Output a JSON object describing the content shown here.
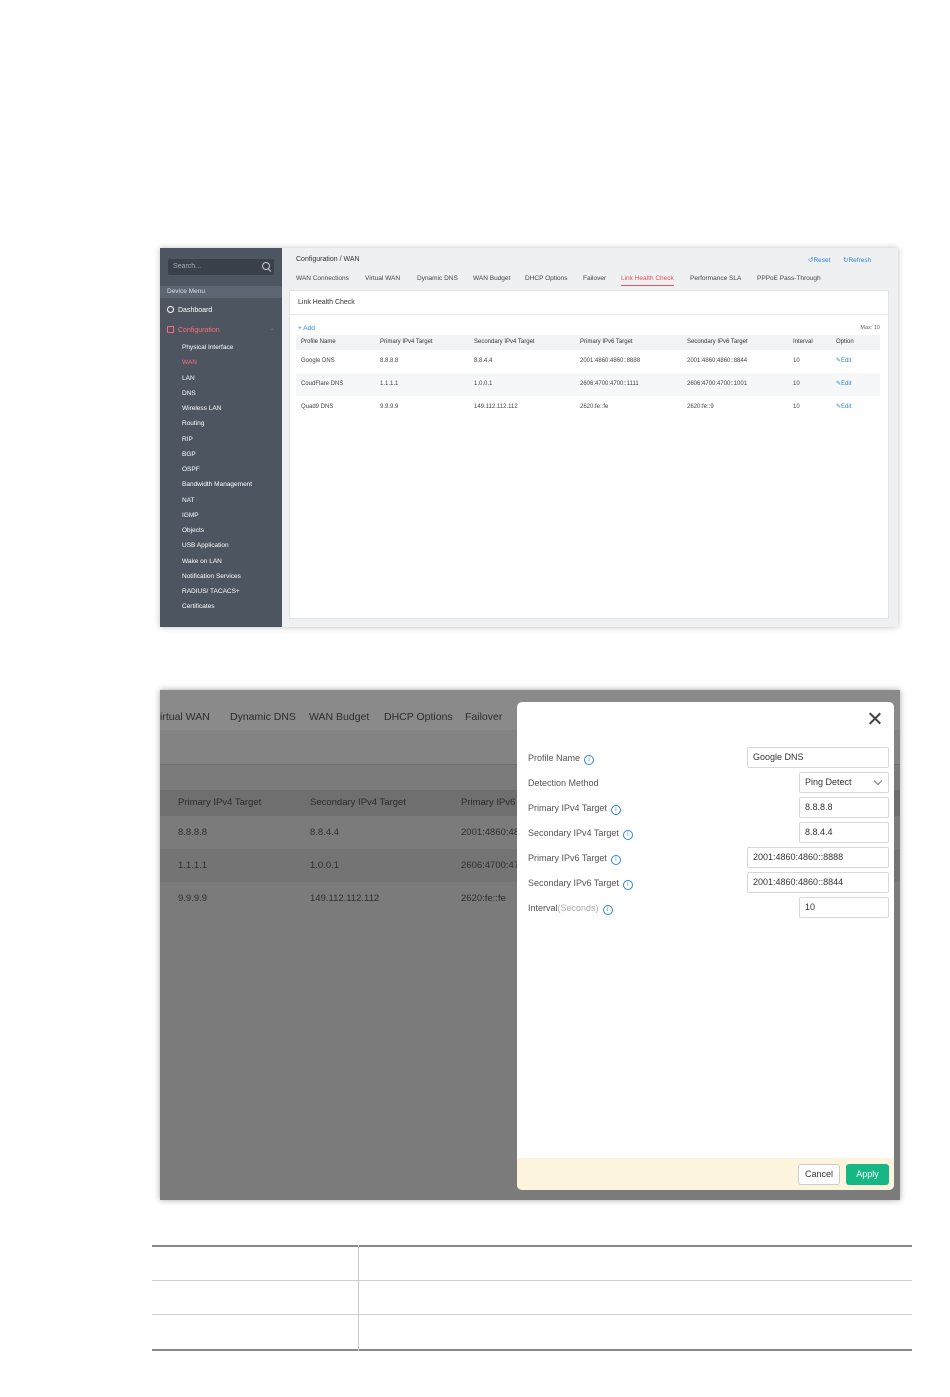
{
  "screen1": {
    "sidebar": {
      "search_placeholder": "Search...",
      "device_menu_label": "Device Menu",
      "dashboard_label": "Dashboard",
      "configuration_label": "Configuration",
      "items": [
        "Physical Interface",
        "WAN",
        "LAN",
        "DNS",
        "Wireless LAN",
        "Routing",
        "RIP",
        "BGP",
        "OSPF",
        "Bandwidth Management",
        "NAT",
        "IGMP",
        "Objects",
        "USB Application",
        "Wake on LAN",
        "Notification Services",
        "RADIUS/ TACACS+",
        "Certificates"
      ],
      "active_item": "WAN"
    },
    "breadcrumb": "Configuration / WAN",
    "reset_label": "Reset",
    "refresh_label": "Refresh",
    "tabs": [
      "WAN Connections",
      "Virtual WAN",
      "Dynamic DNS",
      "WAN Budget",
      "DHCP Options",
      "Failover",
      "Link Health Check",
      "Performance SLA",
      "PPPoE Pass-Through"
    ],
    "active_tab": "Link Health Check",
    "panel_title": "Link Health Check",
    "add_label": "+ Add",
    "max_label": "Max: 10",
    "table": {
      "columns": [
        "Profile Name",
        "Primary IPv4 Target",
        "Secondary IPv4 Target",
        "Primary IPv6 Target",
        "Secondary IPv6 Target",
        "Interval",
        "Option"
      ],
      "rows": [
        [
          "Google DNS",
          "8.8.8.8",
          "8.8.4.4",
          "2001:4860:4860::8888",
          "2001:4860:4860::8844",
          "10",
          "Edit"
        ],
        [
          "CoudFlare DNS",
          "1.1.1.1",
          "1.0.0.1",
          "2606:4700:4700::1111",
          "2606:4700:4700::1001",
          "10",
          "Edit"
        ],
        [
          "Quad9 DNS",
          "9.9.9.9",
          "149.112.112.112",
          "2620:fe::fe",
          "2620:fe::9",
          "10",
          "Edit"
        ]
      ]
    }
  },
  "screen2": {
    "bg_tabs": [
      "irtual WAN",
      "Dynamic DNS",
      "WAN Budget",
      "DHCP Options",
      "Failover"
    ],
    "bg_columns": [
      "Primary IPv4 Target",
      "Secondary IPv4 Target",
      "Primary IPv6 T"
    ],
    "bg_rows": [
      [
        "8.8.8.8",
        "8.8.4.4",
        "2001:4860:48"
      ],
      [
        "1.1.1.1",
        "1.0.0.1",
        "2606:4700:47"
      ],
      [
        "9.9.9.9",
        "149.112.112.112",
        "2620:fe::fe"
      ]
    ],
    "modal": {
      "profile_name_label": "Profile Name",
      "profile_name_value": "Google DNS",
      "detection_method_label": "Detection Method",
      "detection_method_value": "Ping Detect",
      "primary_ipv4_label": "Primary IPv4 Target",
      "primary_ipv4_value": "8.8.8.8",
      "secondary_ipv4_label": "Secondary IPv4 Target",
      "secondary_ipv4_value": "8.8.4.4",
      "primary_ipv6_label": "Primary IPv6 Target",
      "primary_ipv6_value": "2001:4860:4860::8888",
      "secondary_ipv6_label": "Secondary IPv6 Target",
      "secondary_ipv6_value": "2001:4860:4860::8844",
      "interval_label": "Interval",
      "interval_unit": "(Seconds)",
      "interval_value": "10",
      "cancel_label": "Cancel",
      "apply_label": "Apply"
    }
  },
  "icons": {
    "info": "i",
    "reset": "↺",
    "refresh": "↻",
    "edit": "✎"
  },
  "colors": {
    "accent": "#e8505b",
    "link": "#2f86d6",
    "apply": "#16b784",
    "sidebar": "#4d5561"
  }
}
